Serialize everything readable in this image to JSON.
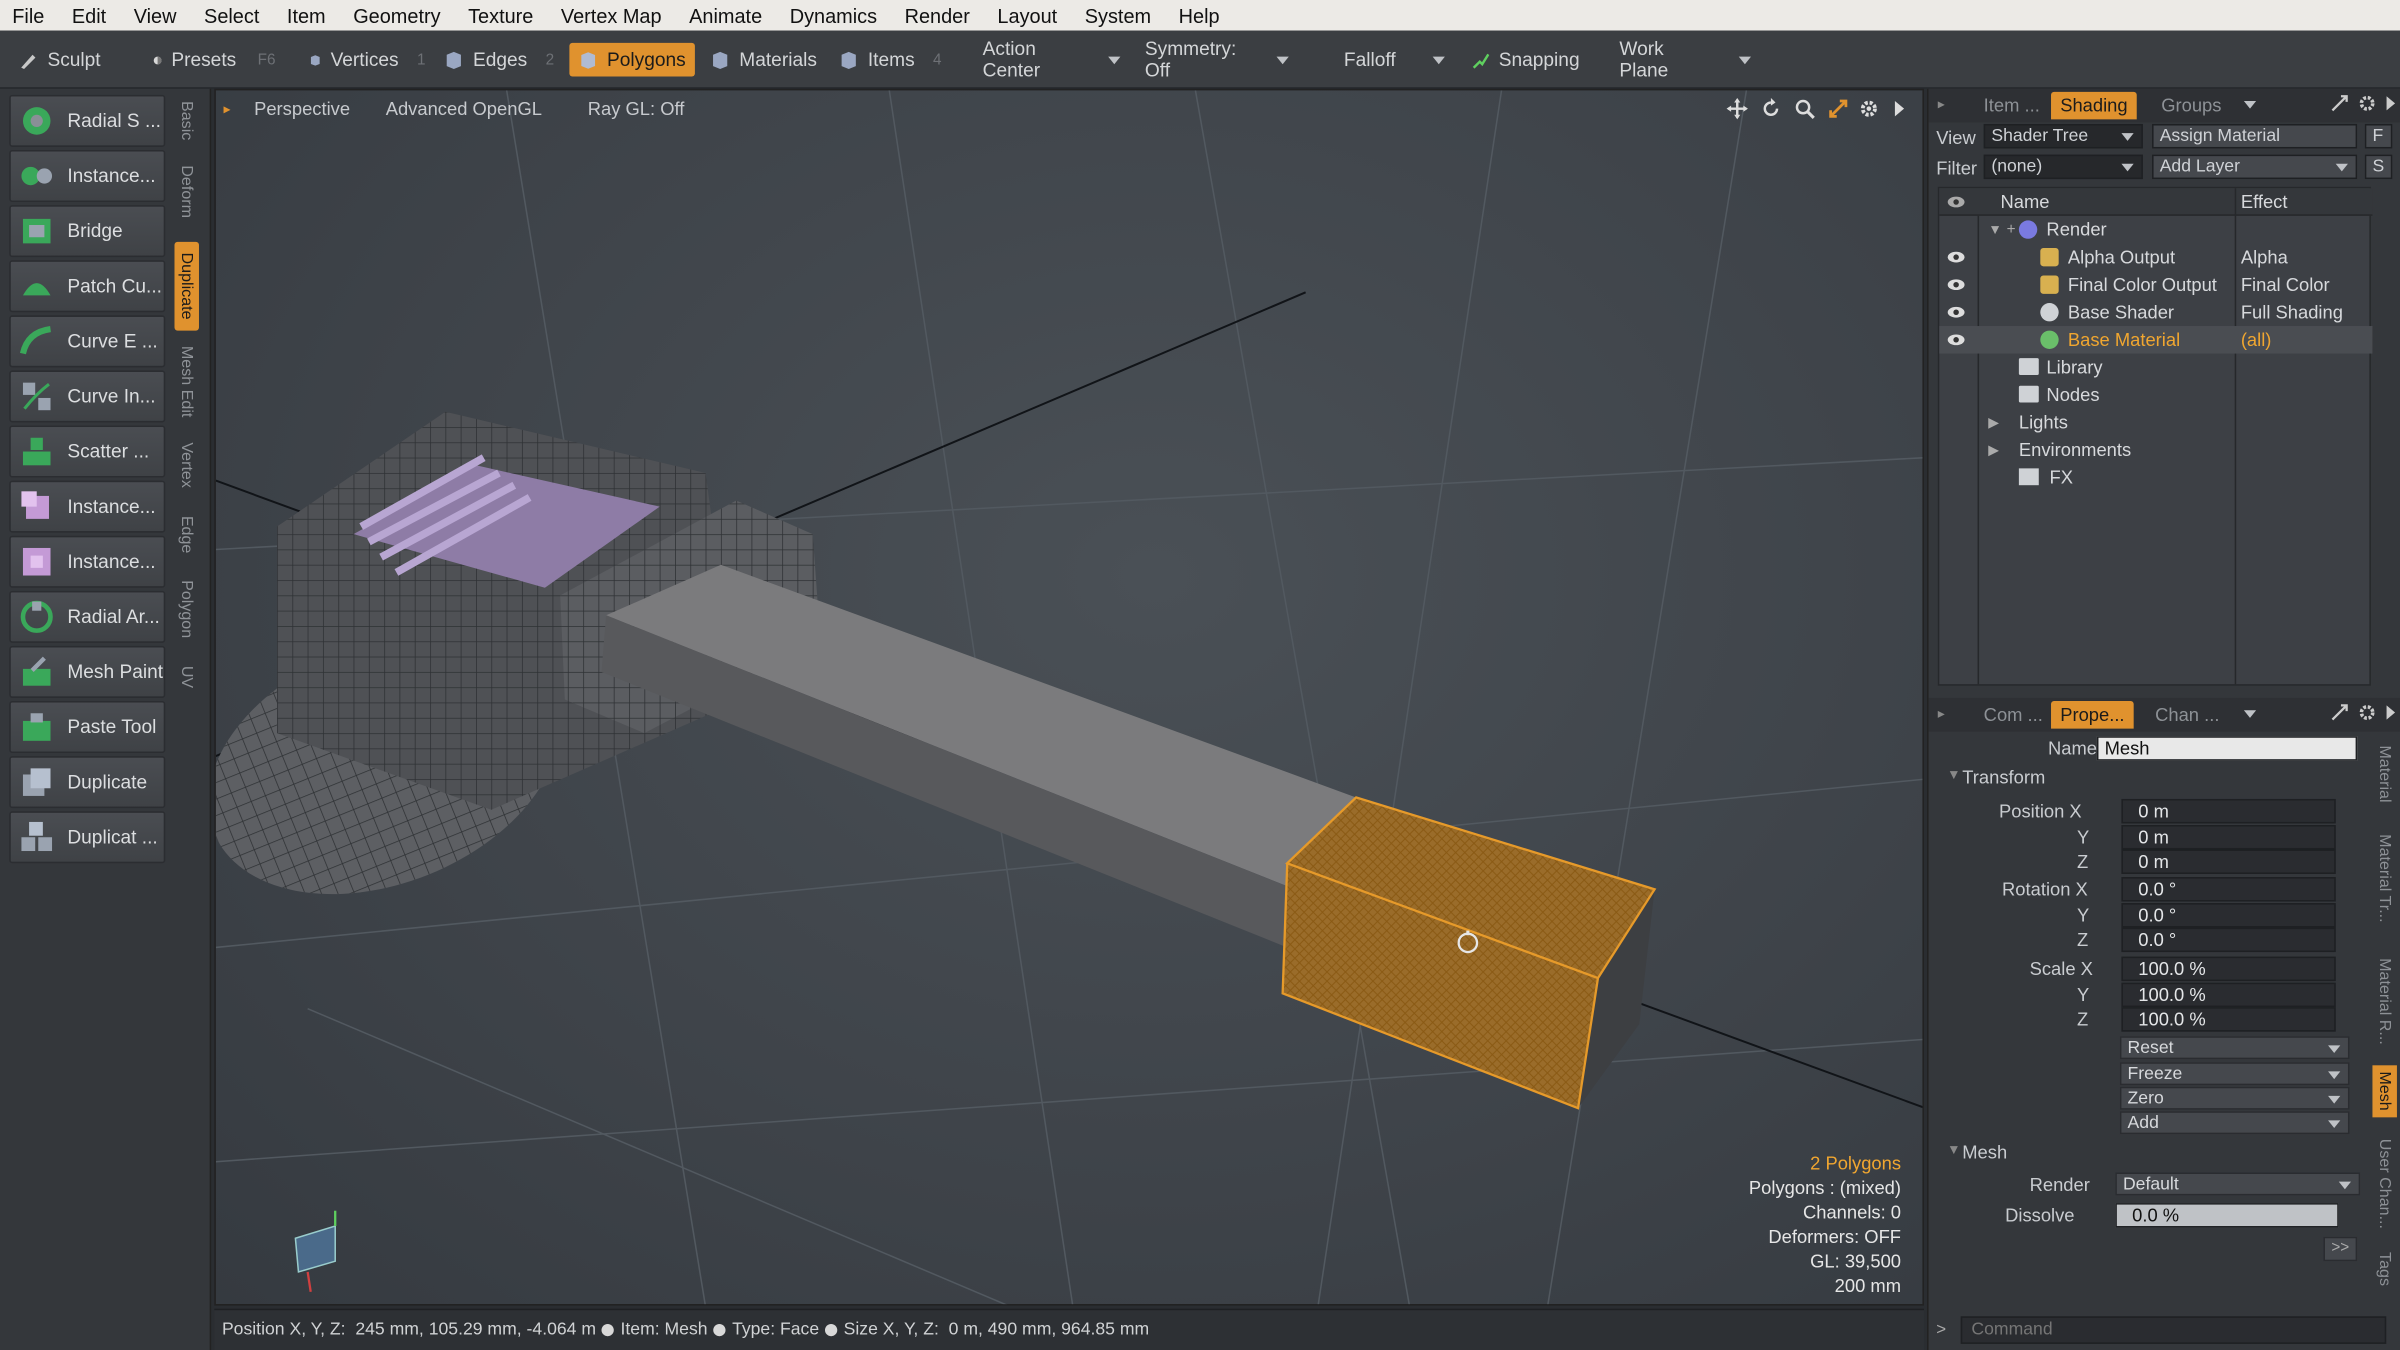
{
  "menu": [
    "File",
    "Edit",
    "View",
    "Select",
    "Item",
    "Geometry",
    "Texture",
    "Vertex Map",
    "Animate",
    "Dynamics",
    "Render",
    "Layout",
    "System",
    "Help"
  ],
  "toolbar": {
    "sculpt": "Sculpt",
    "presets": "Presets",
    "presets_key": "F6",
    "vertices": "Vertices",
    "vertices_num": "1",
    "edges": "Edges",
    "edges_num": "2",
    "polygons": "Polygons",
    "materials": "Materials",
    "items": "Items",
    "items_num": "4",
    "action_center": "Action Center",
    "symmetry": "Symmetry: Off",
    "falloff": "Falloff",
    "snapping": "Snapping",
    "work_plane": "Work Plane"
  },
  "toolbox": {
    "tools": [
      "Radial S ...",
      "Instance...",
      "Bridge",
      "Patch Cu...",
      "Curve E ...",
      "Curve In...",
      "Scatter ...",
      "Instance...",
      "Instance...",
      "Radial Ar...",
      "Mesh Paint",
      "Paste Tool",
      "Duplicate",
      "Duplicat ..."
    ],
    "tabs": [
      "Basic",
      "Deform",
      "Duplicate",
      "Mesh Edit",
      "Vertex",
      "Edge",
      "Polygon",
      "UV"
    ],
    "selected_tab": "Duplicate"
  },
  "viewport": {
    "view": "Perspective",
    "renderer": "Advanced OpenGL",
    "raygl": "Ray GL: Off",
    "stats": {
      "polygons": "2 Polygons",
      "poly_type": "Polygons : (mixed)",
      "channels": "Channels: 0",
      "deformers": "Deformers: OFF",
      "gl": "GL: 39,500",
      "grid": "200 mm"
    }
  },
  "statusbar": {
    "position_label": "Position X, Y, Z:",
    "position_value": "245 mm, 105.29 mm, -4.064 m",
    "item": "Item: Mesh",
    "type": "Type: Face",
    "size_label": "Size X, Y, Z:",
    "size_value": "0 m, 490 mm, 964.85 mm"
  },
  "shading_panel": {
    "tabs": [
      "Item ...",
      "Shading",
      "Groups"
    ],
    "selected_tab": "Shading",
    "view_label": "View",
    "view_value": "Shader Tree",
    "assign_material": "Assign Material",
    "f_button": "F",
    "filter_label": "Filter",
    "filter_value": "(none)",
    "add_layer": "Add Layer",
    "s_button": "S",
    "col_name": "Name",
    "col_effect": "Effect",
    "rows": [
      {
        "name": "Render",
        "effect": ""
      },
      {
        "name": "Alpha Output",
        "effect": "Alpha"
      },
      {
        "name": "Final Color Output",
        "effect": "Final Color"
      },
      {
        "name": "Base Shader",
        "effect": "Full Shading"
      },
      {
        "name": "Base Material",
        "effect": "(all)"
      },
      {
        "name": "Library",
        "effect": ""
      },
      {
        "name": "Nodes",
        "effect": ""
      },
      {
        "name": "Lights",
        "effect": ""
      },
      {
        "name": "Environments",
        "effect": ""
      },
      {
        "name": "FX",
        "effect": ""
      }
    ]
  },
  "properties_panel": {
    "tabs": [
      "Com ...",
      "Prope...",
      "Chan ..."
    ],
    "selected_tab": "Prope...",
    "name_label": "Name",
    "name_value": "Mesh",
    "transform_header": "Transform",
    "position_label": "Position X",
    "rotation_label": "Rotation X",
    "scale_label": "Scale X",
    "y_label": "Y",
    "z_label": "Z",
    "position": [
      "0 m",
      "0 m",
      "0 m"
    ],
    "rotation": [
      "0.0 °",
      "0.0 °",
      "0.0 °"
    ],
    "scale": [
      "100.0 %",
      "100.0 %",
      "100.0 %"
    ],
    "buttons": [
      "Reset",
      "Freeze",
      "Zero",
      "Add"
    ],
    "mesh_header": "Mesh",
    "render_label": "Render",
    "render_value": "Default",
    "dissolve_label": "Dissolve",
    "dissolve_value": "0.0 %",
    "more": ">>",
    "side_tabs": [
      "Material",
      "Material Tr...",
      "Material R...",
      "Mesh",
      "User Chan...",
      "Tags"
    ],
    "selected_side_tab": "Mesh"
  },
  "command": {
    "prompt": ">",
    "placeholder": "Command"
  },
  "colors": {
    "accent": "#e0922e",
    "highlight": "#f0a630",
    "background": "#3e4349"
  }
}
